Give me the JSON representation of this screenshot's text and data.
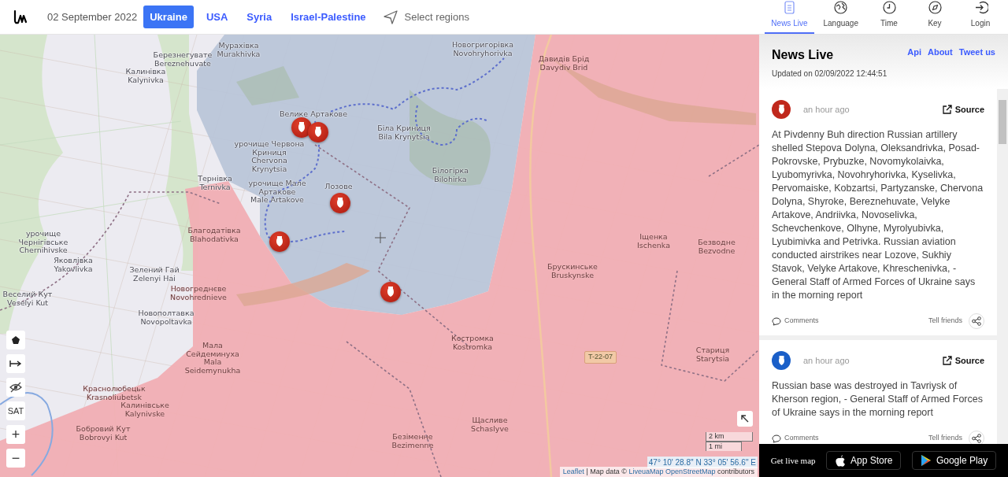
{
  "header": {
    "date": "02 September 2022",
    "regions": [
      {
        "label": "Ukraine",
        "selected": true
      },
      {
        "label": "USA",
        "selected": false
      },
      {
        "label": "Syria",
        "selected": false
      },
      {
        "label": "Israel-Palestine",
        "selected": false
      }
    ],
    "select_regions": "Select regions"
  },
  "nav_tabs": [
    {
      "label": "News Live",
      "kind": "news",
      "selected": true
    },
    {
      "label": "Language",
      "kind": "language",
      "selected": false
    },
    {
      "label": "Time",
      "kind": "time",
      "selected": false
    },
    {
      "label": "Key",
      "kind": "key",
      "selected": false
    },
    {
      "label": "Login",
      "kind": "login",
      "selected": false
    }
  ],
  "map": {
    "places": [
      {
        "uk": "Мурахівка",
        "en": "Murakhivka"
      },
      {
        "uk": "Березнегувате",
        "en": "Bereznehuvate"
      },
      {
        "uk": "Калинівка",
        "en": "Kalynivka"
      },
      {
        "uk": "Велике Артакове"
      },
      {
        "uk": "урочище Червона Криниця",
        "en": "Chervona Krynytsia"
      },
      {
        "uk": "Тернівка",
        "en": "Ternivka"
      },
      {
        "uk": "урочище Мале Артакове",
        "en": "Male Artakove"
      },
      {
        "uk": "Лозове"
      },
      {
        "uk": "Благодатівка",
        "en": "Blahodativka"
      },
      {
        "uk": "урочище Чернігівське",
        "en": "Chernihivske"
      },
      {
        "uk": "Яковлівка",
        "en": "Yakovlivka"
      },
      {
        "uk": "Зелений Гай",
        "en": "Zelenyi Hai"
      },
      {
        "uk": "Веселий Кут",
        "en": "Veselyi Kut"
      },
      {
        "uk": "Новогреднєве",
        "en": "Novohrednieve"
      },
      {
        "uk": "Новополтавка",
        "en": "Novopoltavka"
      },
      {
        "uk": "Мала Сейдеминуха",
        "en": "Mala Seidemynukha"
      },
      {
        "uk": "Краснолюбецьк",
        "en": "Krasnoliubetsk"
      },
      {
        "uk": "Калинівське",
        "en": "Kalynivske"
      },
      {
        "uk": "Бобровий Кут",
        "en": "Bobrovyi Kut"
      },
      {
        "uk": "Новогригорівка",
        "en": "Novohryhorivka"
      },
      {
        "uk": "Давидів Брід",
        "en": "Davydiv Brid"
      },
      {
        "uk": "Біла Криниця",
        "en": "Bila Krynytsia"
      },
      {
        "uk": "Білогірка",
        "en": "Bilohirka"
      },
      {
        "uk": "Іщенка",
        "en": "Ischenka"
      },
      {
        "uk": "Безводне",
        "en": "Bezvodne"
      },
      {
        "uk": "Брускинське",
        "en": "Bruskynske"
      },
      {
        "uk": "Костромка",
        "en": "Kostromka"
      },
      {
        "uk": "Стариця",
        "en": "Starytsia"
      },
      {
        "uk": "Щасливе",
        "en": "Schaslyve"
      },
      {
        "uk": "Безіменне",
        "en": "Bezimenne"
      }
    ],
    "road_label": "T-22-07",
    "controls": {
      "satellite": "SAT",
      "zoom_in": "+",
      "zoom_out": "−"
    },
    "scale": [
      "2 km",
      "1 mi"
    ],
    "coordinates": "47° 10' 28.8'' N 33° 05' 56.6'' E",
    "attribution": {
      "leaflet": "Leaflet",
      "middle": " | Map data © ",
      "sources": [
        "LiveuaMap",
        "OpenStreetMap"
      ],
      "suffix": " contributors"
    }
  },
  "news": {
    "title": "News Live",
    "links": [
      "Api",
      "About",
      "Tweet us"
    ],
    "updated": "Updated on 02/09/2022 12:44:51",
    "items": [
      {
        "color": "#c0281c",
        "time": "an hour ago",
        "source": "Source",
        "text": "At Pivdenny Buh direction Russian artillery shelled Stepova Dolyna, Oleksandrivka, Posad-Pokrovske, Prybuzke, Novomykolaivka, Lyubomyrivka, Novohryhorivka, Kyselivka, Pervomaiske, Kobzartsi, Partyzanske, Chervona Dolyna, Shyroke, Bereznehuvate, Velyke Artakove, Andriivka, Novoselivka, Schevchenkove, Olhyne, Myrolyubivka, Lyubimivka and Petrivka. Russian aviation conducted airstrikes near Lozove, Sukhiy Stavok, Velyke Artakove, Khreschenivka, - General Staff of Armed Forces of Ukraine says in the morning report",
        "comments": "Comments",
        "tell": "Tell friends"
      },
      {
        "color": "#1a5fc8",
        "time": "an hour ago",
        "source": "Source",
        "text": "Russian base was destroyed in Tavriysk of Kherson region, - General Staff of Armed Forces of Ukraine says in the morning report",
        "comments": "Comments",
        "tell": "Tell friends"
      }
    ]
  },
  "footer": {
    "label": "Get live map",
    "stores": [
      {
        "kind": "apple",
        "label": "App Store"
      },
      {
        "kind": "google",
        "label": "Google Play"
      }
    ]
  }
}
